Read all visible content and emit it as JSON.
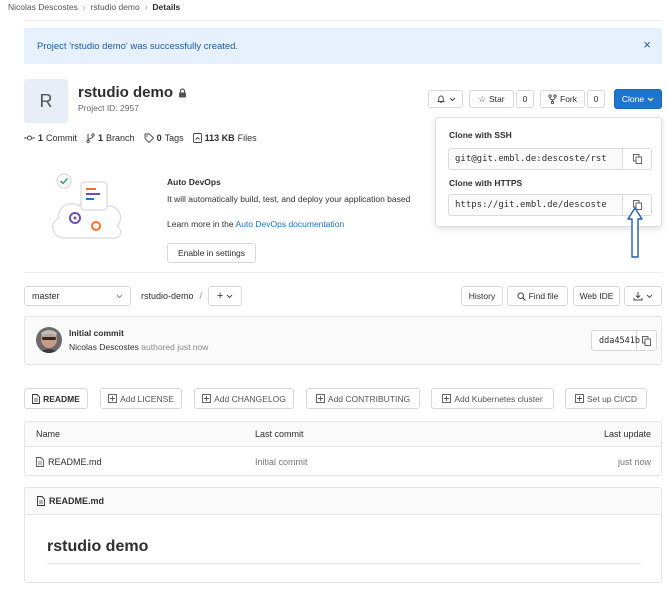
{
  "breadcrumb": {
    "items": [
      "Nicolas Descostes",
      "rstudio demo",
      "Details"
    ]
  },
  "flash": {
    "message": "Project 'rstudio demo' was successfully created.",
    "close": "×"
  },
  "project": {
    "avatar_letter": "R",
    "name": "rstudio demo",
    "id_text": "Project ID: 2957"
  },
  "header_actions": {
    "star_label": "Star",
    "star_count": "0",
    "fork_label": "Fork",
    "fork_count": "0",
    "clone_label": "Clone"
  },
  "stats": {
    "commits": "1",
    "commits_label": "Commit",
    "branches": "1",
    "branches_label": "Branch",
    "tags": "0",
    "tags_label": "Tags",
    "size": "113 KB",
    "size_label": "Files"
  },
  "auto_devops": {
    "title": "Auto DevOps",
    "description": "It will automatically build, test, and deploy your application based",
    "learn_prefix": "Learn more in the",
    "learn_link": "Auto DevOps documentation",
    "enable_button": "Enable in settings"
  },
  "clone_dropdown": {
    "ssh_label": "Clone with SSH",
    "ssh_url": "git@git.embl.de:descoste/rst",
    "https_label": "Clone with HTTPS",
    "https_url": "https://git.embl.de/descoste"
  },
  "repo_bar": {
    "branch": "master",
    "path": "rstudio-demo",
    "path_sep": "/",
    "history": "History",
    "find_file": "Find file",
    "web_ide": "Web IDE"
  },
  "last_commit": {
    "title": "Initial commit",
    "author": "Nicolas Descostes",
    "meta": "authored just now",
    "sha": "dda4541b"
  },
  "actions": {
    "readme": "README",
    "license": "Add LICENSE",
    "changelog": "Add CHANGELOG",
    "contributing": "Add CONTRIBUTING",
    "kubernetes": "Add Kubernetes cluster",
    "cicd": "Set up CI/CD"
  },
  "files": {
    "columns": [
      "Name",
      "Last commit",
      "Last update"
    ],
    "rows": [
      {
        "name": "README.md",
        "last_commit": "Initial commit",
        "last_update": "just now"
      }
    ]
  },
  "readme": {
    "file": "README.md",
    "heading": "rstudio demo"
  },
  "colors": {
    "primary": "#1f75cb",
    "flash_bg": "#e7f1fd",
    "flash_text": "#1f5ba8"
  }
}
